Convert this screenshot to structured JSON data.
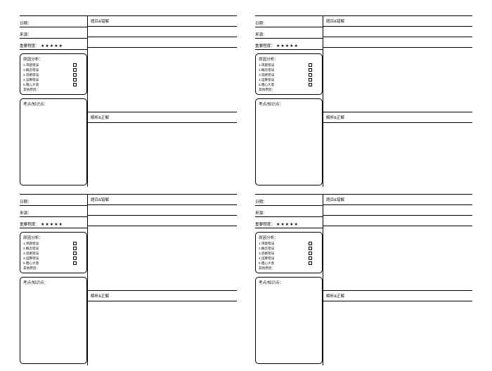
{
  "labels": {
    "date": "日期：",
    "source": "来源：",
    "importance": "重要程度：",
    "question_and_wrong": "题目&错解",
    "analysis_and_correct": "解析&正解",
    "reason_title": "原因分析：",
    "reasons": [
      "1.审题错误",
      "2.概念错误",
      "3.思路错误",
      "4.运算错误",
      "5.粗心大意"
    ],
    "other_reason": "其他原因：",
    "notes_title": "考点/知识点："
  },
  "star_glyph": "★",
  "star_count": 5,
  "block_count": 4
}
